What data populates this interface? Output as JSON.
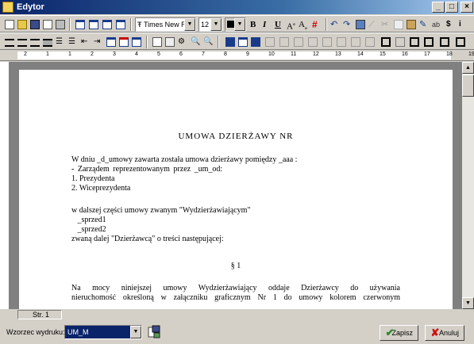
{
  "window": {
    "title": "Edytor",
    "minimize": "_",
    "maximize": "□",
    "close": "×"
  },
  "toolbar": {
    "font_name": "Times New Ro",
    "font_size": "12",
    "bold": "B",
    "italic": "I",
    "underline": "U",
    "superscript": "A",
    "subscript": "A"
  },
  "ruler": {
    "marks": [
      "2",
      "1",
      "1",
      "2",
      "3",
      "4",
      "5",
      "6",
      "7",
      "8",
      "9",
      "10",
      "11",
      "12",
      "13",
      "14",
      "15",
      "16",
      "17",
      "18",
      "19"
    ]
  },
  "document": {
    "title": "UMOWA DZIERŻAWY NR",
    "lines": [
      "W dniu  _d_umowy zawarta została umowa dzierżawy pomiędzy _aaa :",
      " - Zarządem    reprezentowanym    przez  _um_od:",
      "1. Prezydenta",
      "2. Wiceprezydenta",
      "w dalszej części umowy zwanym \"Wydzierżawiającym\"",
      "   _sprzed1",
      "   _sprzed2",
      "zwaną dalej \"Dzierżawcą\" o treści następującej:"
    ],
    "section": "§ 1",
    "paragraph_line1": "Na mocy niniejszej umowy Wydzierżawiający oddaje Dzierżawcy do używania",
    "paragraph_line2": "nieruchomość określoną w załączniku graficznym Nr 1 do umowy kolorem czerwonym"
  },
  "status": {
    "page": "Str. 1"
  },
  "bottom": {
    "template_label": "Wzorzec wydruku:",
    "template_value": "UM_M",
    "save_label": "Zapisz",
    "cancel_label": "Anuluj"
  },
  "colors": {
    "title_bar": "#0a246a",
    "face": "#d4d0c8",
    "save_icon": "#2a8a2a",
    "cancel_icon": "#cc1111"
  }
}
